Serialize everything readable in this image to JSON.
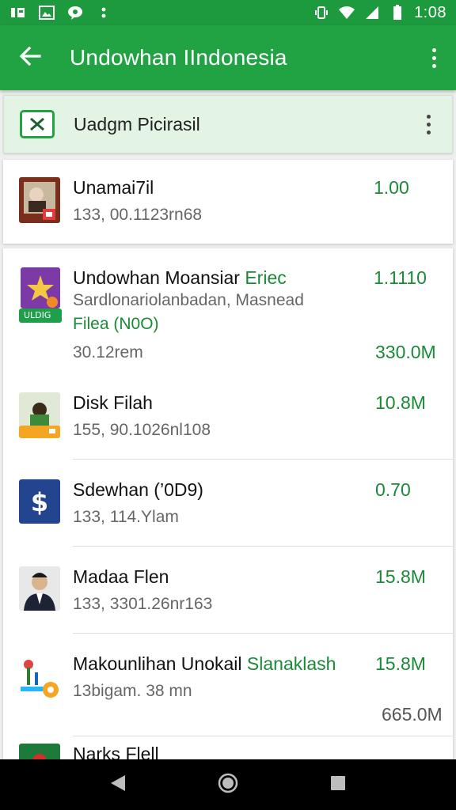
{
  "status_bar": {
    "time": "1:08",
    "left_icons": [
      "sim-card-icon",
      "image-notification-icon",
      "chat-notification-icon",
      "more-notifications-icon"
    ],
    "right_icons": [
      "vibrate-icon",
      "wifi-icon",
      "signal-icon",
      "battery-icon"
    ]
  },
  "app_bar": {
    "title": "Undowhan IIndonesia",
    "color": "#21a344"
  },
  "sub_header": {
    "title": "Uadgm Picirasil"
  },
  "items": [
    {
      "name": "Unamai7il",
      "detail": "133, 00.1123rn68",
      "amount": "1.00"
    },
    {
      "name": "Undowhan Moansiar",
      "name_highlight": "Eriec",
      "detail": "Sardlonariolanbadan, Masnead",
      "detail2": "Filea (N0O)",
      "detail3": "30.12rem",
      "badge": "ULDIG",
      "amount": "1.1110",
      "amount2": "330.0M"
    },
    {
      "name": "Disk Filah",
      "detail": "155, 90.1026nl108",
      "amount": "10.8M"
    },
    {
      "name": "Sdewhan (’0D9)",
      "detail": "133, 114.Ylam",
      "amount": "0.70"
    },
    {
      "name": "Madaa Flen",
      "detail": "133, 3301.26nr163",
      "amount": "15.8M"
    },
    {
      "name": "Makounlihan Unokail",
      "name_highlight": "Slanaklash",
      "detail": "13bigam. 38 mn",
      "amount": "15.8M",
      "amount2": "665.0M"
    },
    {
      "name": "Narks Flell"
    }
  ],
  "colors": {
    "accent": "#21a344",
    "amount_green": "#1a8a36"
  }
}
